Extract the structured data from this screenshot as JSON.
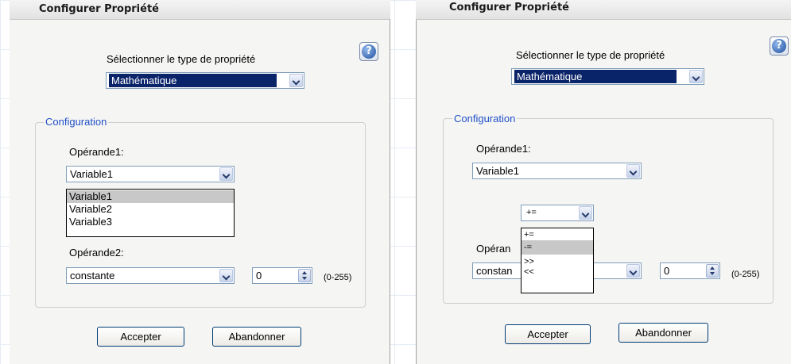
{
  "dialogs": [
    {
      "title": "Configurer Propriété",
      "help_icon": "help-icon",
      "type_label": "Sélectionner le type de propriété",
      "type_value": "Mathématique",
      "group_label": "Configuration",
      "operand1_label": "Opérande1:",
      "operand1_value": "Variable1",
      "operand1_options": [
        "Variable1",
        "Variable2",
        "Variable3"
      ],
      "operand1_highlighted": "Variable1",
      "operand2_label": "Opérande2:",
      "operand2_value": "constante",
      "constant_value": "0",
      "range_label": "(0-255)",
      "accept_label": "Accepter",
      "cancel_label": "Abandonner"
    },
    {
      "title": "Configurer Propriété",
      "help_icon": "help-icon",
      "type_label": "Sélectionner le type de propriété",
      "type_value": "Mathématique",
      "group_label": "Configuration",
      "operand1_label": "Opérande1:",
      "operand1_value": "Variable1",
      "operator_value": "+=",
      "operator_options": [
        "+=",
        "-=",
        ">>",
        "<<"
      ],
      "operator_highlighted": "-=",
      "operand2_label_partial": "Opéran",
      "operand2_value_partial": "constan",
      "constant_value": "0",
      "range_label": "(0-255)",
      "accept_label": "Accepter",
      "cancel_label": "Abandonner"
    }
  ]
}
